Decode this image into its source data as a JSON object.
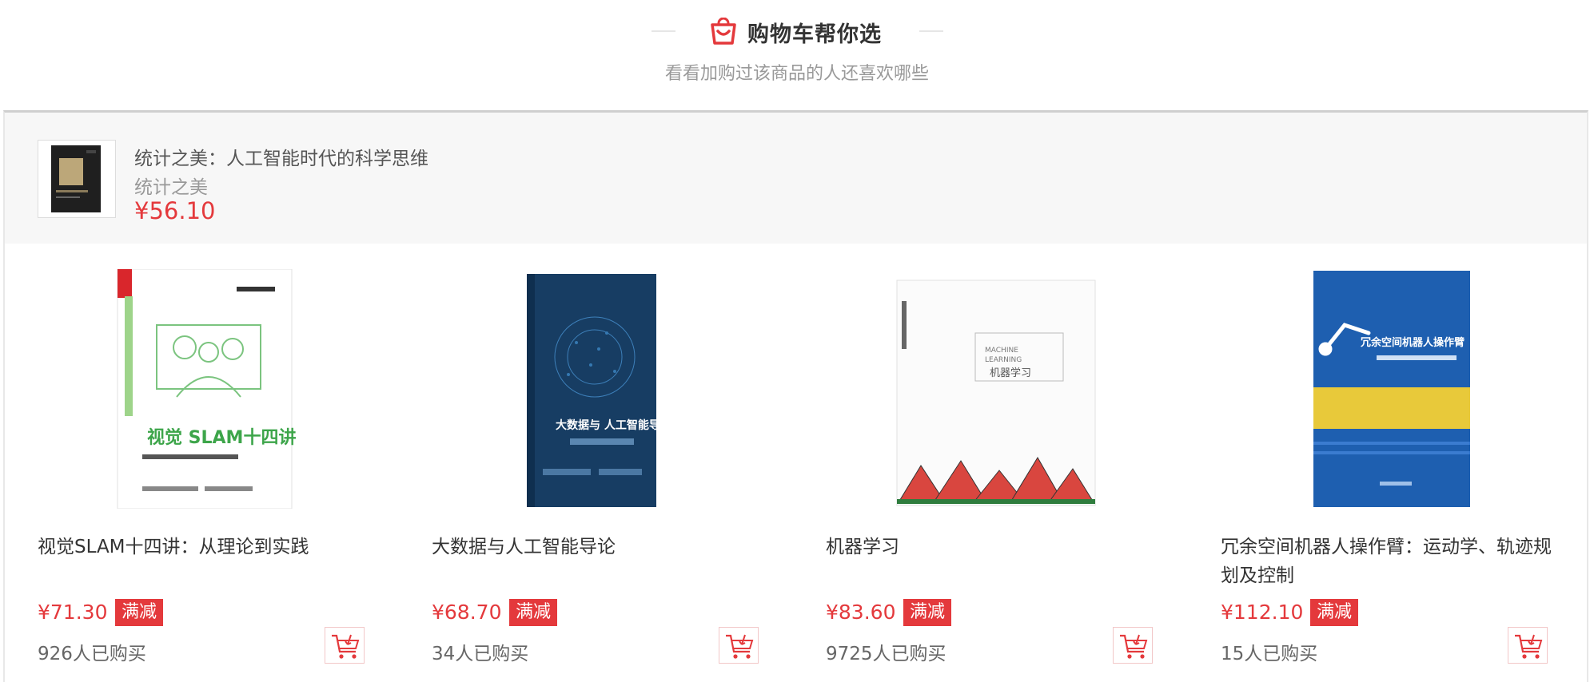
{
  "header": {
    "title": "购物车帮你选",
    "subtitle": "看看加购过该商品的人还喜欢哪些",
    "icon": "shopping-bag-icon",
    "accent": "#e4393c"
  },
  "current_item": {
    "title": "统计之美：人工智能时代的科学思维",
    "subtitle": "统计之美",
    "price": "¥56.10"
  },
  "products": [
    {
      "name": "视觉SLAM十四讲：从理论到实践",
      "price": "¥71.30",
      "tag": "满减",
      "sold": "926人已购买",
      "cover_text": "视觉 SLAM十四讲"
    },
    {
      "name": "大数据与人工智能导论",
      "price": "¥68.70",
      "tag": "满减",
      "sold": "34人已购买",
      "cover_text": "大数据与 人工智能导论"
    },
    {
      "name": "机器学习",
      "price": "¥83.60",
      "tag": "满减",
      "sold": "9725人已购买",
      "cover_text": "机器学习"
    },
    {
      "name": "冗余空间机器人操作臂：运动学、轨迹规划及控制",
      "price": "¥112.10",
      "tag": "满减",
      "sold": "15人已购买",
      "cover_text": "冗余空间机器人操作臂"
    }
  ]
}
